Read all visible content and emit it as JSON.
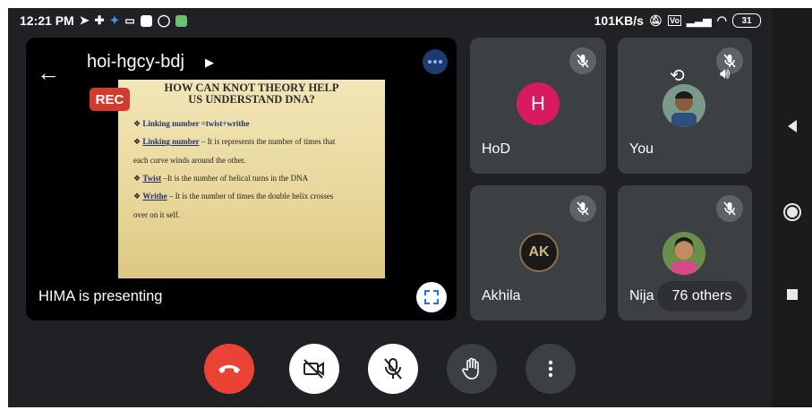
{
  "status_bar": {
    "time": "12:21 PM",
    "net_speed": "101KB/s",
    "battery": "31",
    "left_icons": [
      "send-icon",
      "game-icon",
      "bird-icon",
      "cast-icon",
      "news-icon",
      "whatsapp-icon",
      "app-icon"
    ],
    "right_icons": [
      "mute-notification-icon",
      "volte-icon",
      "signal-icon",
      "wifi-icon"
    ]
  },
  "meeting": {
    "code": "hoi-hgcy-bdj",
    "rec_label": "REC",
    "presenting_text": "HIMA is presenting",
    "slide": {
      "title_line1": "HOW CAN KNOT THEORY HELP",
      "title_line2": "US UNDERSTAND DNA?",
      "b1_term": "Linking number =twist+writhe",
      "b2_term": "Linking number",
      "b2_text": " – It is represents the number of times that",
      "b2_cont": "each curve winds around the other.",
      "b3_term": "Twist",
      "b3_text": " –It is the number of helical turns in the DNA",
      "b4_term": "Writhe",
      "b4_text": " – It is the number of times the double helix crosses",
      "b4_cont": "over on it self."
    }
  },
  "participants": {
    "hod": {
      "name": "HoD",
      "initial": "H"
    },
    "you": {
      "name": "You"
    },
    "akhila": {
      "name": "Akhila",
      "initial": "AK"
    },
    "nija": {
      "name": "Nija"
    },
    "others_label": "76 others"
  },
  "controls": [
    "end-call",
    "camera-off",
    "mic-off",
    "raise-hand",
    "more-options"
  ],
  "colors": {
    "end_call": "#ea4335",
    "rec_badge": "#d23c2f",
    "hod_avatar": "#d81b60",
    "tile_bg": "#3c4043"
  }
}
